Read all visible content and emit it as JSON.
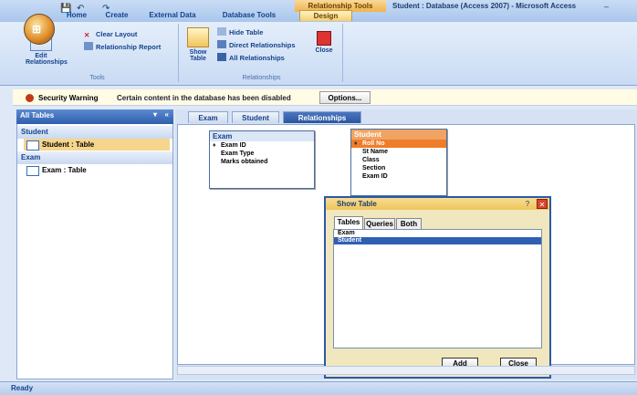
{
  "quick_access": {
    "save_icon": "save-icon",
    "undo_icon": "undo-icon",
    "redo_icon": "redo-icon"
  },
  "title_bar": {
    "context_label": "Relationship Tools",
    "window_title": "Student : Database (Access 2007) - Microsoft Access"
  },
  "ribbon_tabs": [
    "Home",
    "Create",
    "External Data",
    "Database Tools",
    "Design"
  ],
  "ribbon": {
    "tools": {
      "edit_relationships": "Edit Relationships",
      "clear_layout": "Clear Layout",
      "relationship_report": "Relationship Report",
      "group_label": "Tools"
    },
    "relationships": {
      "show_table": "Show Table",
      "hide_table": "Hide Table",
      "direct_relationships": "Direct Relationships",
      "all_relationships": "All Relationships",
      "close": "Close",
      "group_label": "Relationships"
    }
  },
  "security_bar": {
    "title": "Security Warning",
    "message": "Certain content in the database has been disabled",
    "options_button": "Options..."
  },
  "nav_pane": {
    "header": "All Tables",
    "groups": [
      {
        "name": "Student",
        "item": "Student : Table"
      },
      {
        "name": "Exam",
        "item": "Exam : Table"
      }
    ]
  },
  "doc_tabs": [
    "Exam",
    "Student",
    "Relationships"
  ],
  "tables": {
    "exam": {
      "title": "Exam",
      "fields": [
        "Exam ID",
        "Exam Type",
        "Marks obtained"
      ]
    },
    "student": {
      "title": "Student",
      "fields": [
        "Roll No",
        "St Name",
        "Class",
        "Section",
        "Exam ID"
      ]
    }
  },
  "dialog": {
    "title": "Show Table",
    "tabs": [
      "Tables",
      "Queries",
      "Both"
    ],
    "list": [
      "Exam",
      "Student"
    ],
    "selected": "Student",
    "add_button": "Add",
    "close_button": "Close"
  },
  "status_bar": {
    "text": "Ready"
  },
  "colors": {
    "ribbon": "#c9dbf3",
    "context_tab": "#f0b34a",
    "dialog_title": "#efc55b",
    "selection": "#2f5fb3"
  }
}
